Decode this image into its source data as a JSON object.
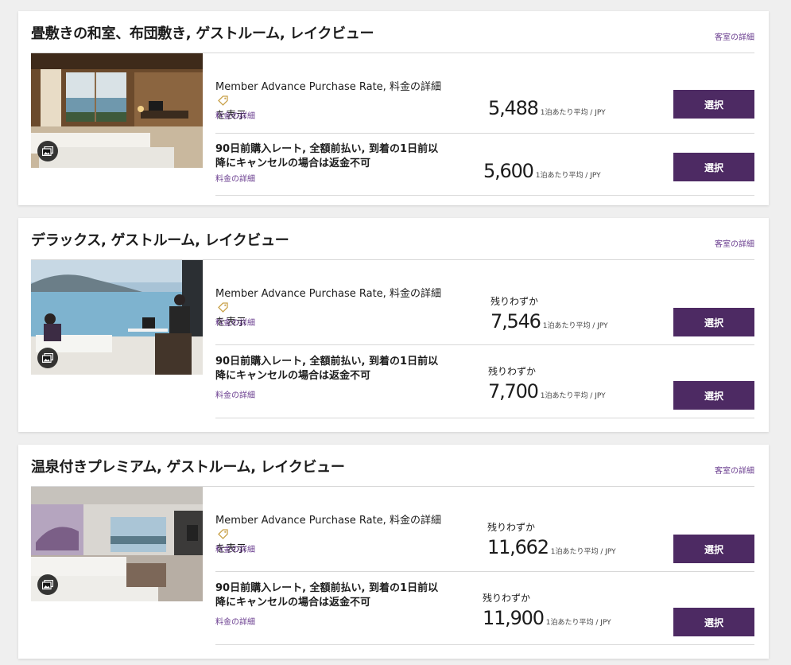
{
  "room_details_label": "客室の詳細",
  "rate_details_label": "料金の詳細",
  "select_label": "選択",
  "per_night_label": "1泊あたり平均 / JPY",
  "low_availability_label": "残りわずか",
  "rates": {
    "member_latin": "Member Advance Purchase Rate, ",
    "member_jp": "料金の詳細",
    "member_line2": "を表示",
    "prepay_line1": "90日前購入レート, 全額前払い, 到着の1日前以",
    "prepay_line2": "降にキャンセルの場合は返金不可"
  },
  "rooms": [
    {
      "title": "畳敷きの和室、布団敷き, ゲストルーム, レイクビュー",
      "member_price": "5,488",
      "prepay_price": "5,600"
    },
    {
      "title": "デラックス, ゲストルーム, レイクビュー",
      "member_price": "7,546",
      "prepay_price": "7,700"
    },
    {
      "title": "温泉付きプレミアム, ゲストルーム, レイクビュー",
      "member_price": "11,662",
      "prepay_price": "11,900"
    }
  ],
  "colors": {
    "accent": "#4d2a63",
    "link": "#6a3d8f",
    "tag_icon": "#c9a24b"
  },
  "icons": {
    "gallery": "gallery-icon",
    "tag": "tag-icon"
  }
}
